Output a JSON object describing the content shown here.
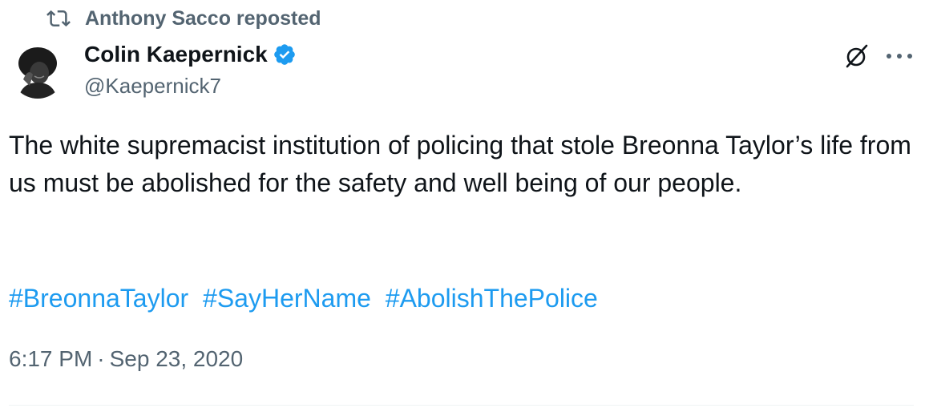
{
  "repost": {
    "icon": "repost-icon",
    "text": "Anthony Sacco reposted"
  },
  "author": {
    "display_name": "Colin Kaepernick",
    "handle": "@Kaepernick7",
    "verified_icon": "verified-badge-icon",
    "avatar": "avatar"
  },
  "actions": {
    "grok_icon": "grok-icon",
    "more_icon": "more-options-icon"
  },
  "tweet": {
    "text": "The white supremacist institution of policing that stole Breonna Taylor’s life from us must be abolished for the safety and well being of our people.",
    "hashtags": [
      "#BreonnaTaylor",
      "#SayHerName",
      "#AbolishThePolice"
    ]
  },
  "meta": {
    "time": "6:17 PM",
    "separator": "·",
    "date": "Sep 23, 2020"
  },
  "colors": {
    "text": "#0f1419",
    "secondary": "#536471",
    "link": "#1d9bf0",
    "divider": "#eff3f4"
  }
}
